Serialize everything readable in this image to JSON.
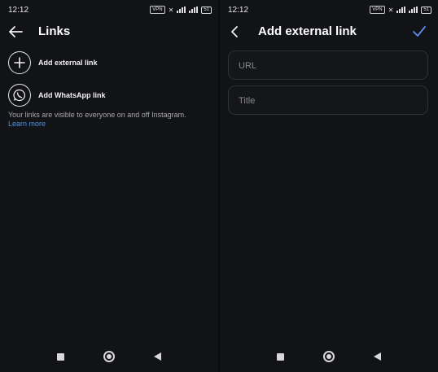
{
  "left": {
    "status": {
      "time": "12:12",
      "vpn": "VPN",
      "battery": "51"
    },
    "header": {
      "title": "Links"
    },
    "items": [
      {
        "label": "Add external link",
        "icon": "plus-icon"
      },
      {
        "label": "Add WhatsApp link",
        "icon": "whatsapp-icon"
      }
    ],
    "note": "Your links are visible to everyone on and off Instagram.",
    "learn_more": "Learn more"
  },
  "right": {
    "status": {
      "time": "12:12",
      "vpn": "VPN",
      "battery": "51"
    },
    "header": {
      "title": "Add external link"
    },
    "fields": [
      {
        "placeholder": "URL",
        "value": ""
      },
      {
        "placeholder": "Title",
        "value": ""
      }
    ]
  },
  "colors": {
    "background": "#121316",
    "accent": "#4a90e2",
    "text": "#ffffff"
  }
}
